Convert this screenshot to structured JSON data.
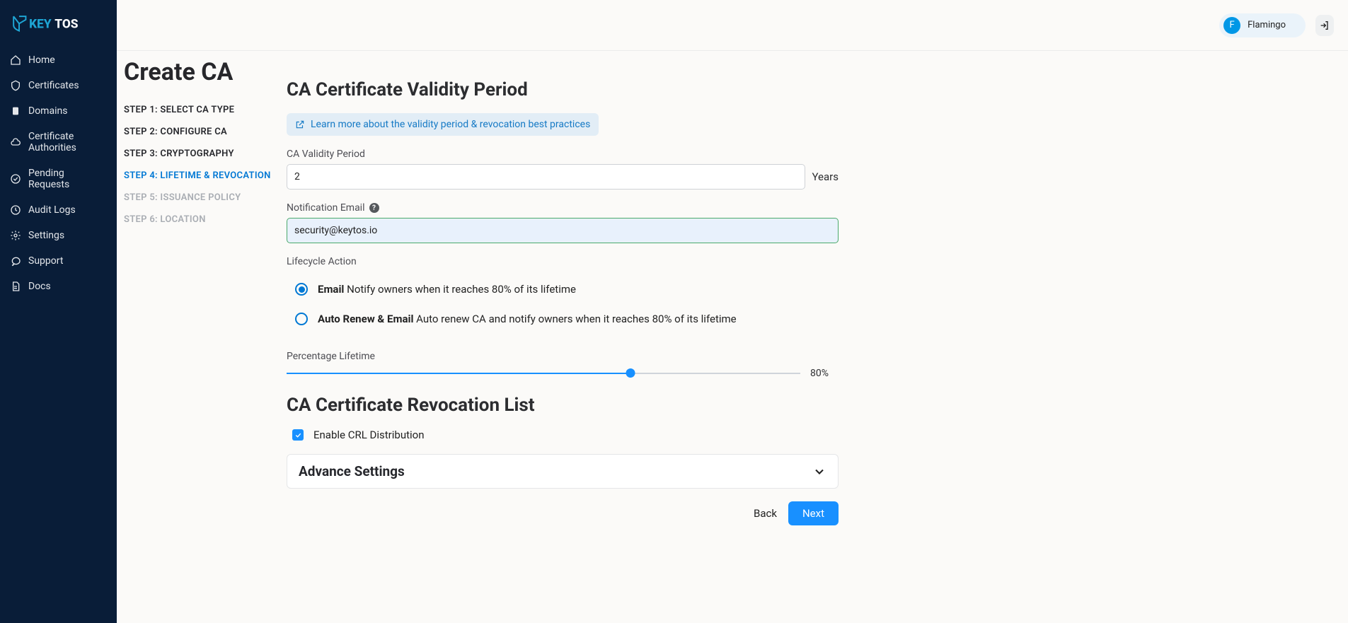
{
  "brand": {
    "name_left": "KEY",
    "name_right": "TOS"
  },
  "user": {
    "initial": "F",
    "name": "Flamingo"
  },
  "sidebar": {
    "items": [
      {
        "label": "Home"
      },
      {
        "label": "Certificates"
      },
      {
        "label": "Domains"
      },
      {
        "label": "Certificate Authorities"
      },
      {
        "label": "Pending Requests"
      },
      {
        "label": "Audit Logs"
      },
      {
        "label": "Settings"
      },
      {
        "label": "Support"
      },
      {
        "label": "Docs"
      }
    ]
  },
  "page": {
    "title": "Create CA"
  },
  "steps": [
    {
      "label": "STEP 1: SELECT CA TYPE",
      "state": "done"
    },
    {
      "label": "STEP 2: CONFIGURE CA",
      "state": "done"
    },
    {
      "label": "STEP 3: CRYPTOGRAPHY",
      "state": "done"
    },
    {
      "label": "STEP 4: LIFETIME & REVOCATION",
      "state": "active"
    },
    {
      "label": "STEP 5: ISSUANCE POLICY",
      "state": "disabled"
    },
    {
      "label": "STEP 6: LOCATION",
      "state": "disabled"
    }
  ],
  "form": {
    "section1": "CA Certificate Validity Period",
    "learn_link": "Learn more about the validity period & revocation best practices",
    "validity_label": "CA Validity Period",
    "validity_value": "2",
    "validity_unit": "Years",
    "email_label": "Notification Email",
    "email_value": "security@keytos.io",
    "lifecycle_label": "Lifecycle Action",
    "radio": [
      {
        "strong": "Email",
        "rest": " Notify owners when it reaches 80% of its lifetime"
      },
      {
        "strong": "Auto Renew & Email",
        "rest": " Auto renew CA and notify owners when it reaches 80% of its lifetime"
      }
    ],
    "radio_selected": 0,
    "percent_label": "Percentage Lifetime",
    "percent_value": "80%",
    "percent_num": 67,
    "section2": "CA Certificate Revocation List",
    "crl_label": "Enable CRL Distribution",
    "crl_checked": true,
    "accordion": "Advance Settings",
    "back": "Back",
    "next": "Next"
  }
}
